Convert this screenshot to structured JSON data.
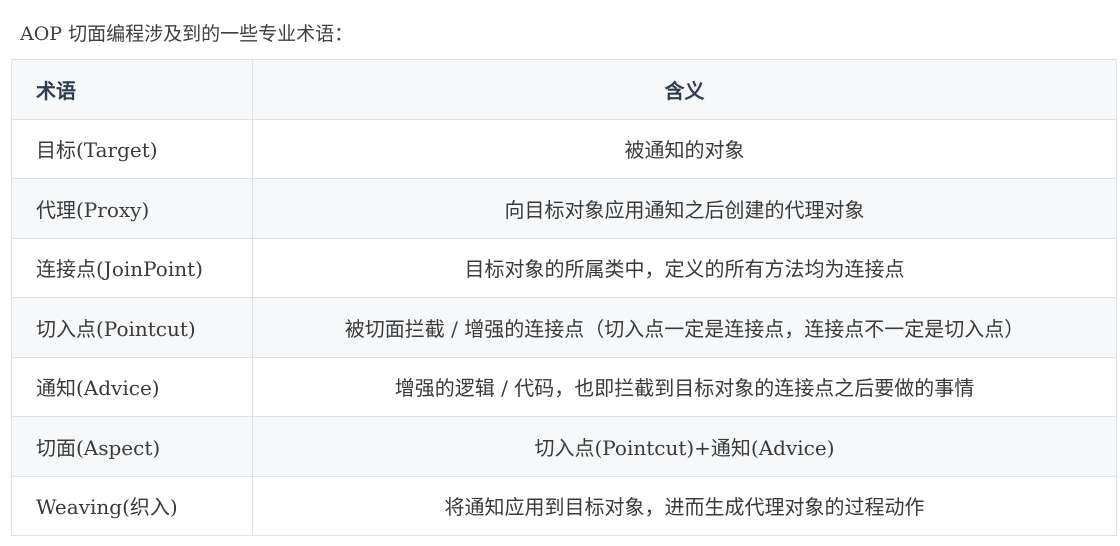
{
  "intro": "AOP 切面编程涉及到的一些专业术语：",
  "table": {
    "headers": [
      "术语",
      "含义"
    ],
    "rows": [
      [
        "目标(Target)",
        "被通知的对象"
      ],
      [
        "代理(Proxy)",
        "向目标对象应用通知之后创建的代理对象"
      ],
      [
        "连接点(JoinPoint)",
        "目标对象的所属类中，定义的所有方法均为连接点"
      ],
      [
        "切入点(Pointcut)",
        "被切面拦截 / 增强的连接点（切入点一定是连接点，连接点不一定是切入点）"
      ],
      [
        "通知(Advice)",
        "增强的逻辑 / 代码，也即拦截到目标对象的连接点之后要做的事情"
      ],
      [
        "切面(Aspect)",
        "切入点(Pointcut)+通知(Advice)"
      ],
      [
        "Weaving(织入)",
        "将通知应用到目标对象，进而生成代理对象的过程动作"
      ]
    ]
  },
  "colors": {
    "header_bg": "#f6f8fa",
    "border": "#dfe2e5",
    "text": "#3f3f3f"
  }
}
